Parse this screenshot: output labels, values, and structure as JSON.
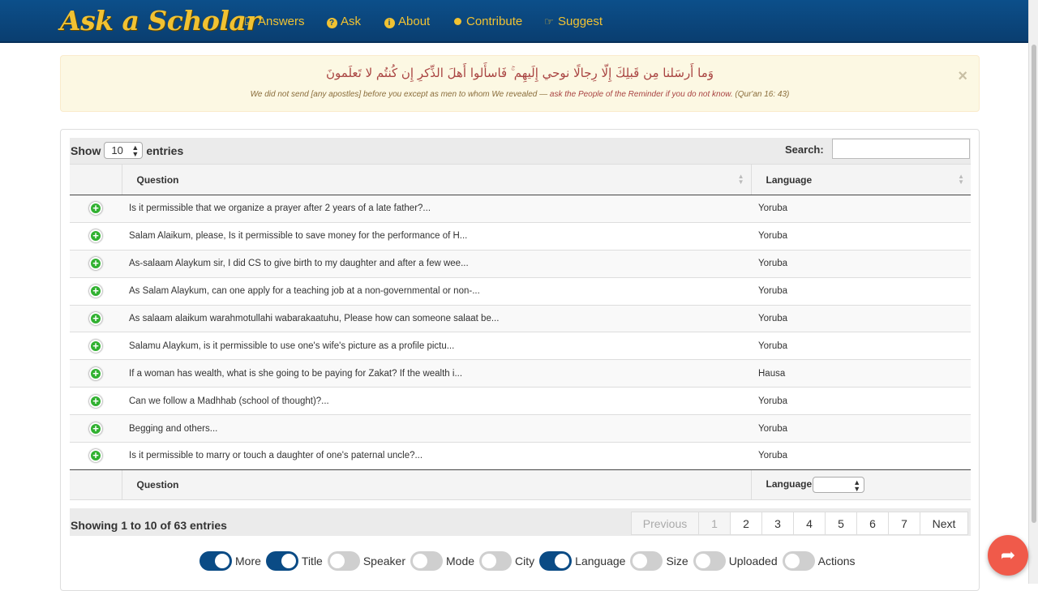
{
  "brand": "Ask a Scholar",
  "nav": [
    {
      "label": "Answers",
      "icon": "check-square-icon",
      "glyph": "☑"
    },
    {
      "label": "Ask",
      "icon": "question-circle-icon",
      "glyph": "?"
    },
    {
      "label": "About",
      "icon": "info-circle-icon",
      "glyph": "i"
    },
    {
      "label": "Contribute",
      "icon": "user-icon",
      "glyph": "👤"
    },
    {
      "label": "Suggest",
      "icon": "thumbs-up-icon",
      "glyph": "☞"
    }
  ],
  "alert": {
    "arabic": "وَما أَرسَلنا مِن قَبلِكَ إِلّا رِجالًا نوحي إِلَيهِم ۚ فَاسأَلوا أَهلَ الذِّكرِ إِن كُنتُم لا تَعلَمونَ",
    "translation_part1": "We did not send [any apostles] before you except as men to whom We revealed — ",
    "translation_part2": "ask the People of the Reminder if you do not know.",
    "translation_part3": " (Qur'an 16: 43)",
    "close": "×"
  },
  "table": {
    "show_label": "Show",
    "entries_value": "10",
    "entries_label": "entries",
    "search_label": "Search:",
    "search_value": "",
    "headers": {
      "question": "Question",
      "language": "Language"
    },
    "rows": [
      {
        "question": "Is it permissible that we organize a prayer after 2 years of a late father?...",
        "language": "Yoruba"
      },
      {
        "question": "Salam Alaikum, please, Is it permissible to save money for the performance of H...",
        "language": "Yoruba"
      },
      {
        "question": "As-salaam Alaykum sir, I did CS to give birth to my daughter and after a few wee...",
        "language": "Yoruba"
      },
      {
        "question": "As Salam Alaykum, can one apply for a teaching job at a non-governmental or non-...",
        "language": "Yoruba"
      },
      {
        "question": "As salaam alaikum warahmotullahi wabarakaatuhu, Please how can someone salaat be...",
        "language": "Yoruba"
      },
      {
        "question": "Salamu Alaykum, is it permissible to use one's wife's picture as a profile pictu...",
        "language": "Yoruba"
      },
      {
        "question": "If a woman has wealth, what is she going to be paying for Zakat? If the wealth i...",
        "language": "Hausa"
      },
      {
        "question": "Can we follow a Madhhab (school of thought)?...",
        "language": "Yoruba"
      },
      {
        "question": "Begging and others...",
        "language": "Yoruba"
      },
      {
        "question": "Is it permissible to marry or touch a daughter of one's paternal uncle?...",
        "language": "Yoruba"
      }
    ],
    "footer": {
      "question": "Question",
      "language": "Language",
      "language_filter": ""
    },
    "info": "Showing 1 to 10 of 63 entries",
    "pagination": {
      "previous": "Previous",
      "pages": [
        "1",
        "2",
        "3",
        "4",
        "5",
        "6",
        "7"
      ],
      "current": "1",
      "next": "Next"
    }
  },
  "column_toggles": [
    {
      "label": "More",
      "on": true
    },
    {
      "label": "Title",
      "on": true
    },
    {
      "label": "Speaker",
      "on": false
    },
    {
      "label": "Mode",
      "on": false
    },
    {
      "label": "City",
      "on": false
    },
    {
      "label": "Language",
      "on": true
    },
    {
      "label": "Size",
      "on": false
    },
    {
      "label": "Uploaded",
      "on": false
    },
    {
      "label": "Actions",
      "on": false
    }
  ],
  "fab": {
    "icon": "share-icon",
    "glyph": "➦"
  },
  "colors": {
    "navbar": "#0c4f8a",
    "brand": "#f1c232",
    "alert_bg": "#fcf8e3",
    "alert_text": "#a94442",
    "toggle_on": "#0a4b85",
    "fab": "#f05a4a",
    "plus": "#31b131"
  }
}
